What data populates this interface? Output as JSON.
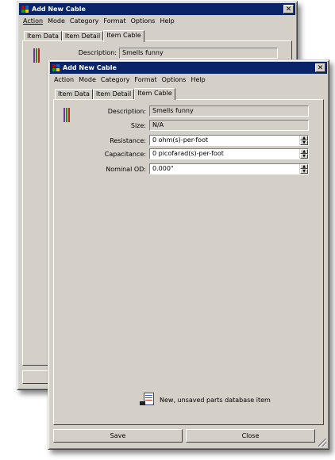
{
  "colors": {
    "titlebar": "#0a246a",
    "window_bg": "#d4d0c8"
  },
  "back_window": {
    "title": "Add New Cable",
    "menu": [
      "Action",
      "Mode",
      "Category",
      "Format",
      "Options",
      "Help"
    ],
    "tabs": [
      "Item Data",
      "Item Detail",
      "Item Cable"
    ],
    "active_tab": "Item Cable",
    "description_label": "Description:",
    "description_value": "Smells funny"
  },
  "front_window": {
    "title": "Add New Cable",
    "menu": [
      "Action",
      "Mode",
      "Category",
      "Format",
      "Options",
      "Help"
    ],
    "tabs": [
      "Item Data",
      "Item Detail",
      "Item Cable"
    ],
    "active_tab": "Item Cable",
    "form": {
      "description": {
        "label": "Description:",
        "value": "Smells funny"
      },
      "size": {
        "label": "Size:",
        "value": "N/A"
      },
      "resistance": {
        "label": "Resistance:",
        "value": "0 ohm(s)-per-foot"
      },
      "capacitance": {
        "label": "Capacitance:",
        "value": "0 picofarad(s)-per-foot"
      },
      "nominal_od": {
        "label": "Nominal OD:",
        "value": "0.000\""
      }
    },
    "status_text": "New, unsaved parts database item",
    "buttons": {
      "save": "Save",
      "close": "Close"
    }
  },
  "icons": [
    "app-icon",
    "close-icon",
    "cable-icon",
    "database-item-icon",
    "resize-grip-icon"
  ]
}
